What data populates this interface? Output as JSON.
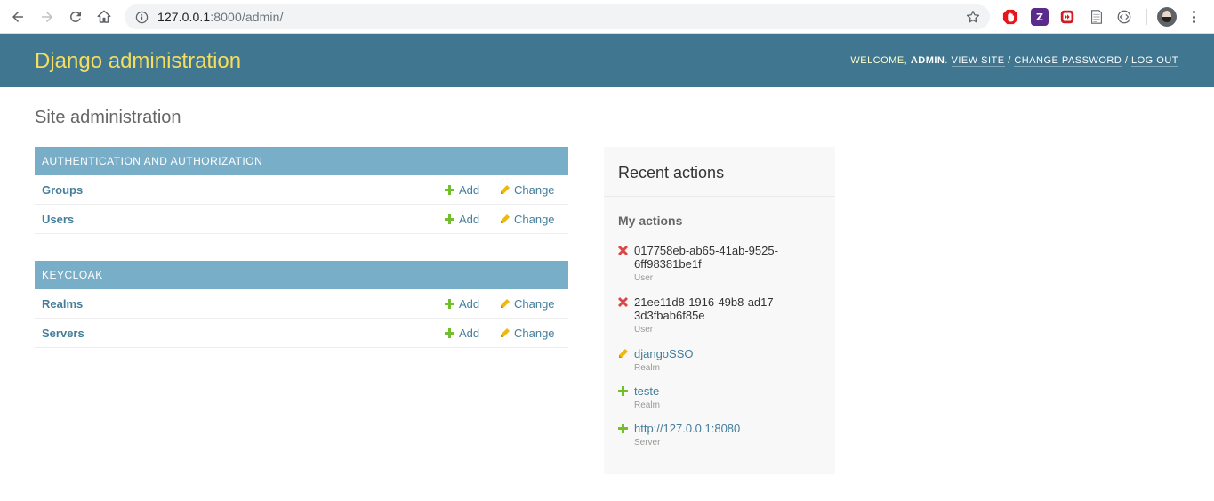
{
  "browser": {
    "url_host": "127.0.0.1",
    "url_rest": ":8000/admin/",
    "colors": {
      "omnibox_bg": "#f1f3f4"
    },
    "icons": [
      "back-arrow-icon",
      "forward-arrow-icon",
      "reload-icon",
      "home-icon",
      "site-info-icon",
      "bookmark-star-icon",
      "extension-stop-icon",
      "extension-z-icon",
      "extension-record-icon",
      "extension-page-icon",
      "extension-code-icon",
      "profile-avatar-icon",
      "browser-menu-icon"
    ]
  },
  "header": {
    "branding": "Django administration",
    "welcome": "Welcome,",
    "username": "admin",
    "view_site": "View site",
    "change_password": "Change password",
    "log_out": "Log out",
    "colors": {
      "bar": "#417690",
      "branding": "#f5dd5d"
    }
  },
  "page_title": "Site administration",
  "modules": {
    "auth": {
      "caption": "Authentication and Authorization",
      "rows": [
        {
          "name": "Groups",
          "add": "Add",
          "change": "Change"
        },
        {
          "name": "Users",
          "add": "Add",
          "change": "Change"
        }
      ]
    },
    "keycloak": {
      "caption": "Keycloak",
      "rows": [
        {
          "name": "Realms",
          "add": "Add",
          "change": "Change"
        },
        {
          "name": "Servers",
          "add": "Add",
          "change": "Change"
        }
      ]
    }
  },
  "recent": {
    "title": "Recent actions",
    "subtitle": "My actions",
    "items": [
      {
        "action": "delete",
        "line1": "017758eb-ab65-41ab-9525-",
        "line2": "6ff98381be1f",
        "type": "User"
      },
      {
        "action": "delete",
        "line1": "21ee11d8-1916-49b8-ad17-",
        "line2": "3d3fbab6f85e",
        "type": "User"
      },
      {
        "action": "change",
        "line1": "djangoSSO",
        "line2": "",
        "type": "Realm"
      },
      {
        "action": "add",
        "line1": "teste",
        "line2": "",
        "type": "Realm"
      },
      {
        "action": "add",
        "line1": "http://127.0.0.1:8080",
        "line2": "",
        "type": "Server"
      }
    ]
  }
}
